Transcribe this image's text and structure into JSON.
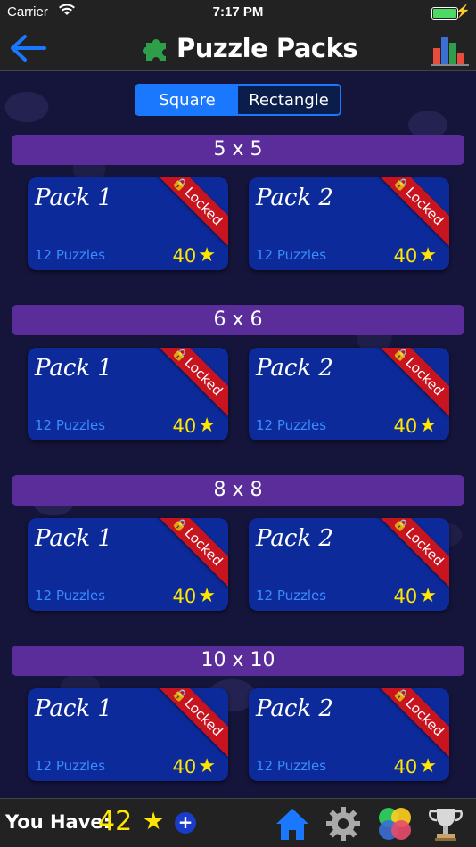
{
  "status_bar": {
    "carrier": "Carrier",
    "time": "7:17 PM"
  },
  "header": {
    "title": "Puzzle Packs"
  },
  "segment": {
    "options": [
      "Square",
      "Rectangle"
    ],
    "selected": "Square"
  },
  "sections": [
    {
      "label": "5 x 5",
      "packs": [
        {
          "name": "Pack 1",
          "puzzles": "12 Puzzles",
          "cost": "40",
          "status": "Locked"
        },
        {
          "name": "Pack 2",
          "puzzles": "12 Puzzles",
          "cost": "40",
          "status": "Locked"
        }
      ]
    },
    {
      "label": "6 x 6",
      "packs": [
        {
          "name": "Pack 1",
          "puzzles": "12 Puzzles",
          "cost": "40",
          "status": "Locked"
        },
        {
          "name": "Pack 2",
          "puzzles": "12 Puzzles",
          "cost": "40",
          "status": "Locked"
        }
      ]
    },
    {
      "label": "8 x 8",
      "packs": [
        {
          "name": "Pack 1",
          "puzzles": "12 Puzzles",
          "cost": "40",
          "status": "Locked"
        },
        {
          "name": "Pack 2",
          "puzzles": "12 Puzzles",
          "cost": "40",
          "status": "Locked"
        }
      ]
    },
    {
      "label": "10 x 10",
      "packs": [
        {
          "name": "Pack 1",
          "puzzles": "12 Puzzles",
          "cost": "40",
          "status": "Locked"
        },
        {
          "name": "Pack 2",
          "puzzles": "12 Puzzles",
          "cost": "40",
          "status": "Locked"
        }
      ]
    }
  ],
  "footer": {
    "you_have_label": "You Have:",
    "stars": "42"
  },
  "colors": {
    "accent": "#1a78ff",
    "section": "#5b2d9b",
    "card": "#0d2a9a",
    "ribbon": "#c8141e",
    "star": "#ffe600"
  },
  "icons": [
    "back-arrow-icon",
    "puzzle-piece-icon",
    "bar-chart-icon",
    "lock-icon",
    "star-icon",
    "plus-icon",
    "home-icon",
    "gear-icon",
    "game-center-icon",
    "trophy-icon"
  ]
}
